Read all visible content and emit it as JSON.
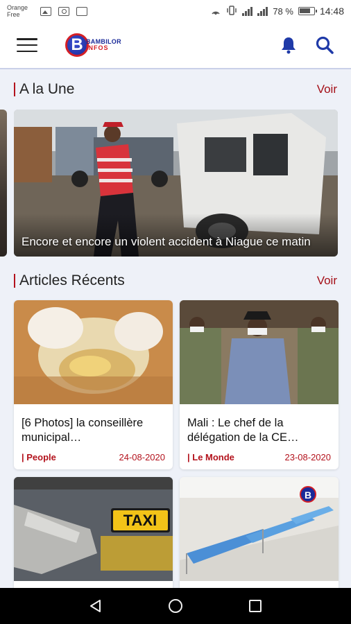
{
  "status_bar": {
    "carrier_line1": "Orange",
    "carrier_line2": "Free",
    "battery": "78 %",
    "time": "14:48"
  },
  "app_bar": {
    "logo_line1": "BAMBILOR",
    "logo_line2": "INFOS",
    "logo_letter": "B"
  },
  "featured_section": {
    "title": "A la Une",
    "see_all": "Voir",
    "article": {
      "caption": "Encore et encore un violent accident à Niague ce matin"
    }
  },
  "recent_section": {
    "title": "Articles Récents",
    "see_all": "Voir",
    "articles": [
      {
        "title": "[6 Photos] la conseillère municipal…",
        "category": "People",
        "date": "24-08-2020"
      },
      {
        "title": "Mali : Le chef de la délégation de la CE…",
        "category": "Le Monde",
        "date": "23-08-2020"
      },
      {
        "taxi_sign": "TAXI"
      },
      {
        "watermark": "B"
      }
    ]
  },
  "colors": {
    "accent": "#b3121c",
    "brand_blue": "#1a2a99",
    "icon_blue": "#1f3aa8"
  }
}
